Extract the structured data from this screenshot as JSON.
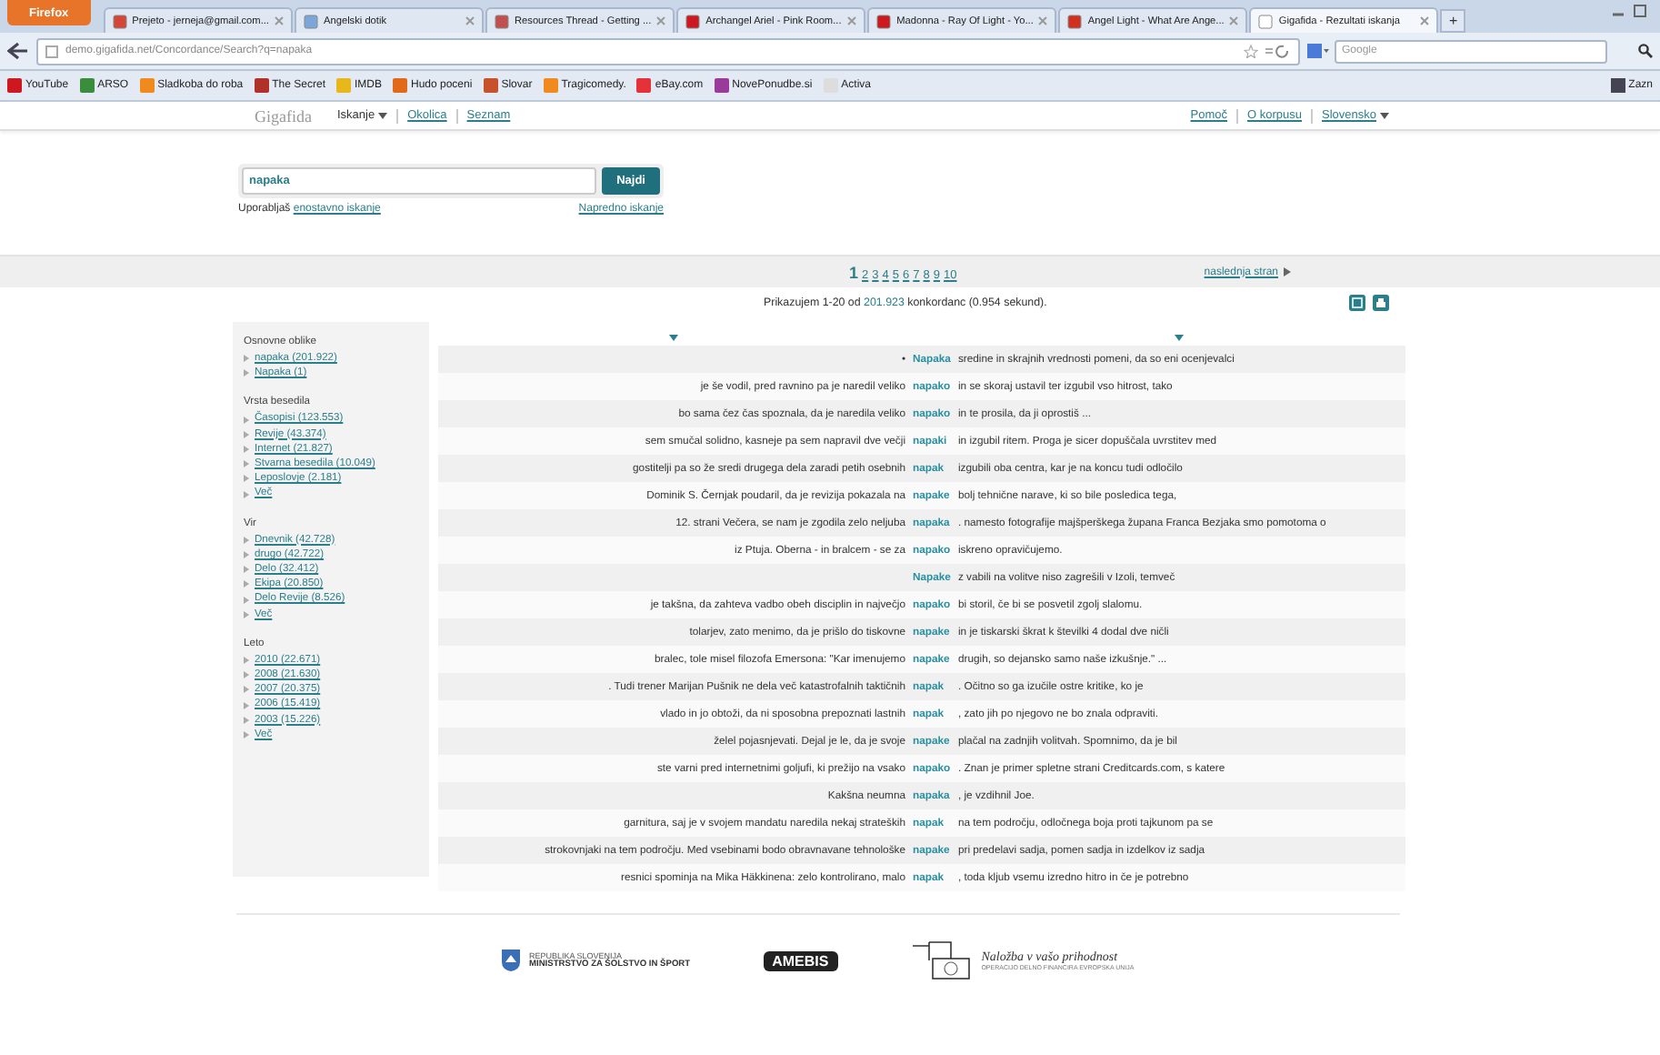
{
  "browser": {
    "menu_button": "Firefox",
    "tabs": [
      {
        "label": "Prejeto - jerneja@gmail.com...",
        "selected": false,
        "color": "#d44638"
      },
      {
        "label": "Angelski dotik",
        "selected": false,
        "color": "#7aa7d8"
      },
      {
        "label": "Resources Thread - Getting ...",
        "selected": false,
        "color": "#c0504d"
      },
      {
        "label": "Archangel Ariel - Pink Room...",
        "selected": false,
        "color": "#cc181e"
      },
      {
        "label": "Madonna - Ray Of Light - Yo...",
        "selected": false,
        "color": "#cc181e"
      },
      {
        "label": "Angel Light - What Are Ange...",
        "selected": false,
        "color": "#d03020"
      },
      {
        "label": "Gigafida - Rezultati iskanja",
        "selected": true,
        "color": "#ffffff"
      }
    ],
    "new_tab": "+",
    "address": "demo.gigafida.net/Concordance/Search?q=napaka",
    "search_field": {
      "placeholder": "Google"
    },
    "bookmarks": [
      {
        "label": "YouTube",
        "color": "#cc181e"
      },
      {
        "label": "ARSO",
        "color": "#3a8d3a"
      },
      {
        "label": "Sladkoba do roba",
        "color": "#f08a1c"
      },
      {
        "label": "The Secret",
        "color": "#b0302a"
      },
      {
        "label": "IMDB",
        "color": "#e8b71a"
      },
      {
        "label": "Hudo poceni",
        "color": "#e06a1a"
      },
      {
        "label": "Slovar",
        "color": "#c8502a"
      },
      {
        "label": "Tragicomedy.",
        "color": "#f08a1c"
      },
      {
        "label": "eBay.com",
        "color": "#e53238"
      },
      {
        "label": "NovePonudbe.si",
        "color": "#9a3a9a"
      },
      {
        "label": "Activa",
        "color": "#dddddd"
      }
    ],
    "bookmarks_menu": "Zazn"
  },
  "site": {
    "logo": "Gigafida",
    "nav": [
      {
        "label": "Iskanje",
        "dropdown": true
      },
      {
        "label": "Okolica",
        "dropdown": false
      },
      {
        "label": "Seznam",
        "dropdown": false
      }
    ],
    "right_nav": [
      {
        "label": "Pomoč",
        "dropdown": false
      },
      {
        "label": "O korpusu",
        "dropdown": false
      },
      {
        "label": "Slovensko",
        "dropdown": true
      }
    ]
  },
  "search": {
    "value": "napaka",
    "button": "Najdi",
    "mode_prefix": "Uporabljaš",
    "mode_link": "enostavno iskanje",
    "advanced_link": "Napredno iskanje"
  },
  "pager": {
    "pages": [
      {
        "label": "1",
        "selected": true
      },
      {
        "label": "2",
        "selected": false
      },
      {
        "label": "3",
        "selected": false
      },
      {
        "label": "4",
        "selected": false
      },
      {
        "label": "5",
        "selected": false
      },
      {
        "label": "6",
        "selected": false
      },
      {
        "label": "7",
        "selected": false
      },
      {
        "label": "8",
        "selected": false
      },
      {
        "label": "9",
        "selected": false
      },
      {
        "label": "10",
        "selected": false
      }
    ],
    "next": "naslednja stran"
  },
  "summary": {
    "prefix": "Prikazujem 1-20 od",
    "count": "201.923",
    "suffix": "konkordanc (0.954 sekund)."
  },
  "sidebar": [
    {
      "title": "Osnovne oblike",
      "items": [
        "napaka (201.922)",
        "Napaka (1)"
      ]
    },
    {
      "title": "Vrsta besedila",
      "items": [
        "Časopisi (123.553)",
        "Revije (43.374)",
        "Internet (21.827)",
        "Stvarna besedila (10.049)",
        "Leposlovje (2.181)",
        "Več"
      ]
    },
    {
      "title": "Vir",
      "items": [
        "Dnevnik (42.728)",
        "drugo (42.722)",
        "Delo (32.412)",
        "Ekipa (20.850)",
        "Delo Revije (8.526)",
        "Več"
      ]
    },
    {
      "title": "Leto",
      "items": [
        "2010 (22.671)",
        "2008 (21.630)",
        "2007 (20.375)",
        "2006 (15.419)",
        "2003 (15.226)",
        "Več"
      ]
    }
  ],
  "rows": [
    {
      "left": "•",
      "keyword": "Napaka",
      "right": "sredine in skrajnih vrednosti pomeni, da so eni ocenjevalci"
    },
    {
      "left": "je še vodil, pred ravnino pa je naredil veliko",
      "keyword": "napako",
      "right": "in se skoraj ustavil ter izgubil vso hitrost, tako"
    },
    {
      "left": "bo sama čez čas spoznala, da je naredila veliko",
      "keyword": "napako",
      "right": "in te prosila, da ji oprostiš ..."
    },
    {
      "left": "sem smučal solidno, kasneje pa sem napravil dve večji",
      "keyword": "napaki",
      "right": "in izgubil ritem. Proga je sicer dopuščala uvrstitev med"
    },
    {
      "left": "gostitelji pa so že sredi drugega dela zaradi petih osebnih",
      "keyword": "napak",
      "right": "izgubili oba centra, kar je na koncu tudi odločilo"
    },
    {
      "left": "Dominik S. Černjak poudaril, da je revizija pokazala na",
      "keyword": "napake",
      "right": "bolj tehnične narave, ki so bile posledica tega,"
    },
    {
      "left": "12. strani Večera, se nam je zgodila zelo neljuba",
      "keyword": "napaka",
      "right": ". namesto fotografije majšperškega župana Franca Bezjaka smo pomotoma o"
    },
    {
      "left": "iz Ptuja. Oberna - in bralcem - se za",
      "keyword": "napako",
      "right": "iskreno opravičujemo."
    },
    {
      "left": "",
      "keyword": "Napake",
      "right": "z vabili na volitve niso zagrešili v Izoli, temveč"
    },
    {
      "left": "je takšna, da zahteva vadbo obeh disciplin in največjo",
      "keyword": "napako",
      "right": "bi storil, če bi se posvetil zgolj slalomu."
    },
    {
      "left": "tolarjev, zato menimo, da je prišlo do tiskovne",
      "keyword": "napake",
      "right": "in je tiskarski škrat k številki 4 dodal dve ničli"
    },
    {
      "left": "bralec, tole misel filozofa Emersona: \"Kar imenujemo",
      "keyword": "napake",
      "right": "drugih, so dejansko samo naše izkušnje.\" ..."
    },
    {
      "left": ". Tudi trener Marijan Pušnik ne dela več katastrofalnih taktičnih",
      "keyword": "napak",
      "right": ". Očitno so ga izučile ostre kritike, ko je"
    },
    {
      "left": "vlado in jo obtoži, da ni sposobna prepoznati lastnih",
      "keyword": "napak",
      "right": ", zato jih po njegovo ne bo znala odpraviti."
    },
    {
      "left": "želel pojasnjevati. Dejal je le, da je svoje",
      "keyword": "napake",
      "right": "plačal na zadnjih volitvah. Spomnimo, da je bil"
    },
    {
      "left": "ste varni pred internetnimi goljufi, ki prežijo na vsako",
      "keyword": "napako",
      "right": ". Znan je primer spletne strani Creditcards.com, s katere"
    },
    {
      "left": "Kakšna neumna",
      "keyword": "napaka",
      "right": ", je vzdihnil Joe."
    },
    {
      "left": "garnitura, saj je v svojem mandatu naredila nekaj strateških",
      "keyword": "napak",
      "right": "na tem področju, odločnega boja proti tajkunom pa se"
    },
    {
      "left": "strokovnjaki na tem področju. Med vsebinami bodo obravnavane tehnološke",
      "keyword": "napake",
      "right": "pri predelavi sadja, pomen sadja in izdelkov iz sadja"
    },
    {
      "left": "resnici spominja na Mika Häkkinena: zelo kontrolirano, malo",
      "keyword": "napak",
      "right": ", toda kljub vsemu izredno hitro in če je potrebno"
    }
  ],
  "footer": {
    "ministry_line1": "REPUBLIKA SLOVENIJA",
    "ministry_line2": "MINISTRSTVO ZA ŠOLSTVO IN ŠPORT",
    "amebis": "AMEBIS",
    "eu_slogan": "Naložba v vašo prihodnost",
    "eu_note": "OPERACIJO DELNO FINANCIRA EVROPSKA UNIJA"
  }
}
